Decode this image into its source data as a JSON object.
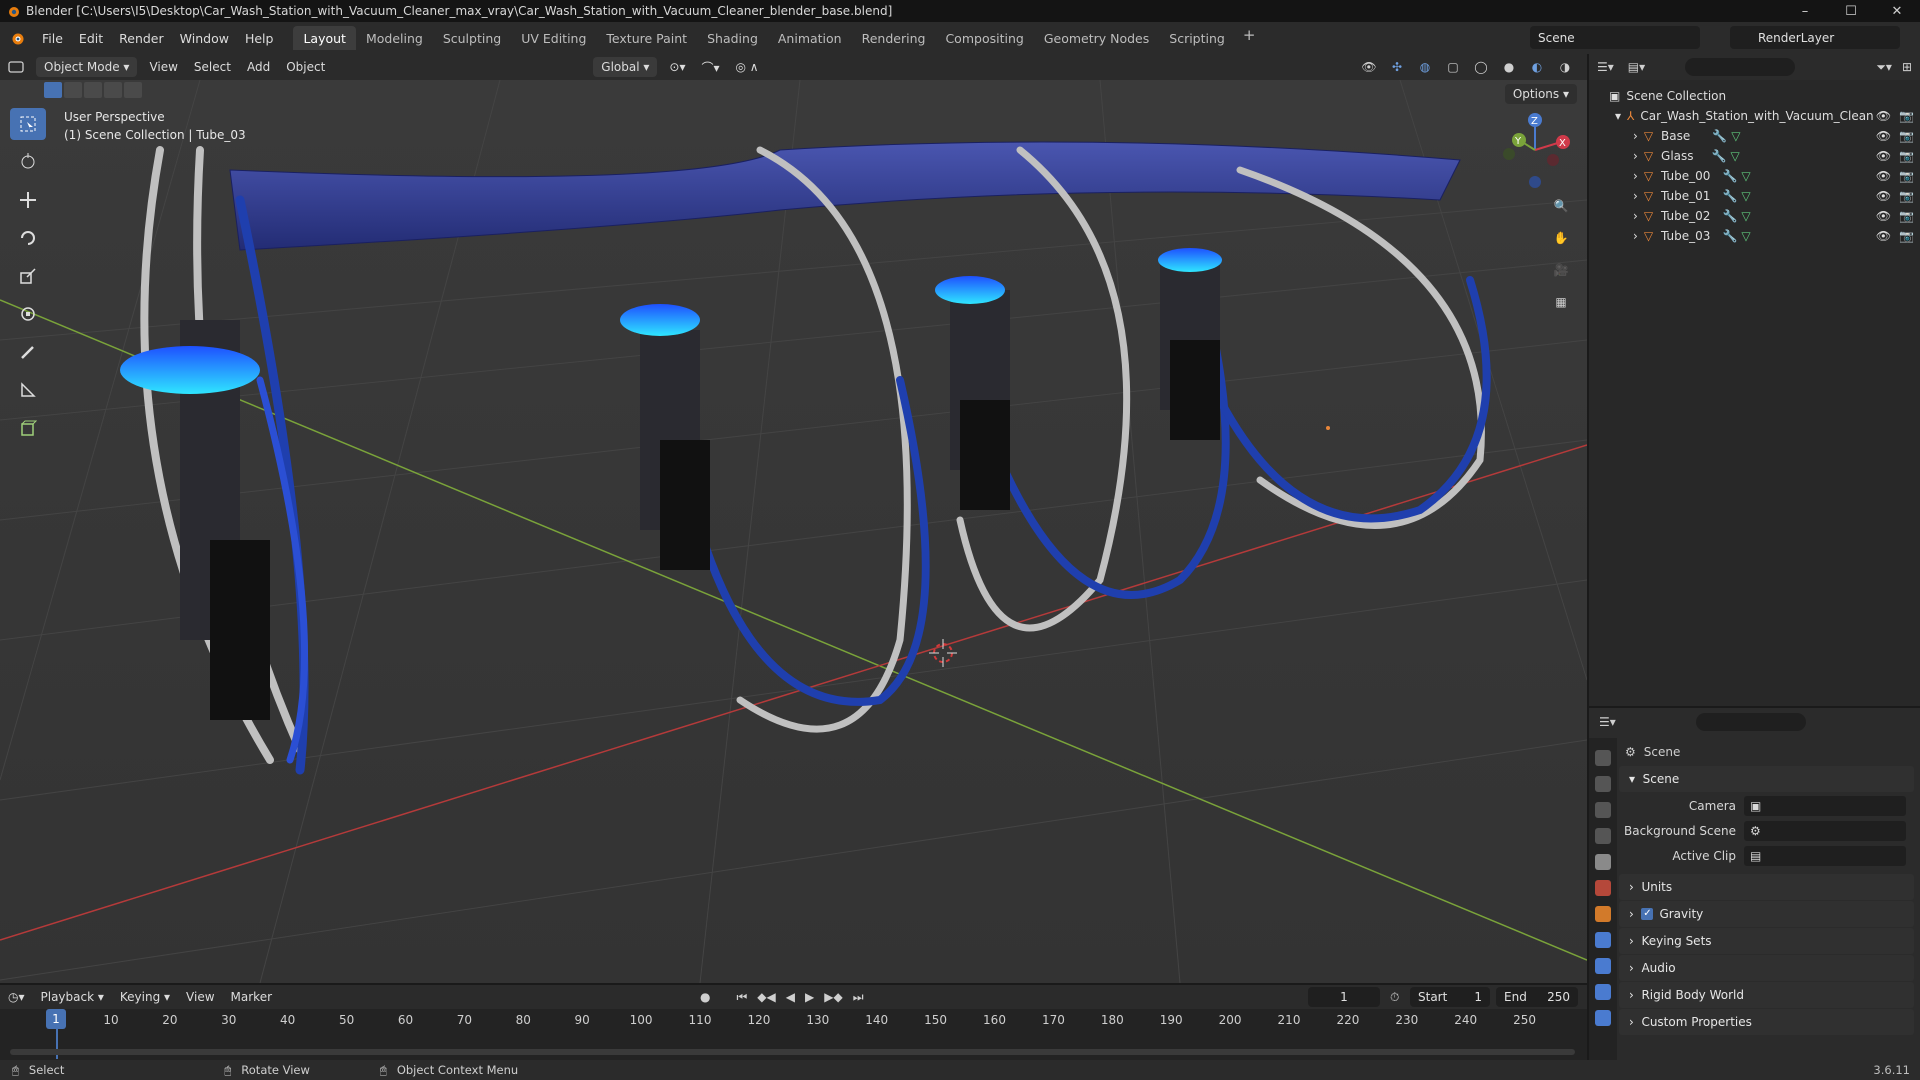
{
  "window": {
    "title": "Blender [C:\\Users\\I5\\Desktop\\Car_Wash_Station_with_Vacuum_Cleaner_max_vray\\Car_Wash_Station_with_Vacuum_Cleaner_blender_base.blend]",
    "controls": [
      "–",
      "☐",
      "✕"
    ]
  },
  "menu": [
    "File",
    "Edit",
    "Render",
    "Window",
    "Help"
  ],
  "workspaces": [
    "Layout",
    "Modeling",
    "Sculpting",
    "UV Editing",
    "Texture Paint",
    "Shading",
    "Animation",
    "Rendering",
    "Compositing",
    "Geometry Nodes",
    "Scripting"
  ],
  "active_workspace": "Layout",
  "scene_name": "Scene",
  "render_layer": "RenderLayer",
  "viewport": {
    "mode": "Object Mode",
    "menus": [
      "View",
      "Select",
      "Add",
      "Object"
    ],
    "orientation": "Global",
    "options_label": "Options",
    "perspective_label": "User Perspective",
    "context_label": "(1) Scene Collection | Tube_03",
    "axes": [
      "X",
      "Y",
      "Z"
    ]
  },
  "outliner": {
    "root": "Scene Collection",
    "collection": "Car_Wash_Station_with_Vacuum_Clean",
    "objects": [
      "Base",
      "Glass",
      "Tube_00",
      "Tube_01",
      "Tube_02",
      "Tube_03"
    ]
  },
  "properties": {
    "context": "Scene",
    "panel_scene": "Scene",
    "labels": {
      "camera": "Camera",
      "background": "Background Scene",
      "clip": "Active Clip"
    },
    "subpanels": [
      "Units",
      "Gravity",
      "Keying Sets",
      "Audio",
      "Rigid Body World",
      "Custom Properties"
    ],
    "gravity_checked": true
  },
  "timeline": {
    "menus": [
      "Playback",
      "Keying",
      "View",
      "Marker"
    ],
    "current_frame": "1",
    "start_label": "Start",
    "start": "1",
    "end_label": "End",
    "end": "250",
    "ruler": [
      "1",
      "10",
      "20",
      "30",
      "40",
      "50",
      "60",
      "70",
      "80",
      "90",
      "100",
      "110",
      "120",
      "130",
      "140",
      "150",
      "160",
      "170",
      "180",
      "190",
      "200",
      "210",
      "220",
      "230",
      "240",
      "250"
    ]
  },
  "status": {
    "select": "Select",
    "rotate": "Rotate View",
    "context": "Object Context Menu",
    "version": "3.6.11"
  },
  "colors": {
    "accent": "#4772b3",
    "mesh_orange": "#e8863a",
    "hose_blue": "#1f3fae",
    "canopy_blue": "#2e3a8c",
    "glow_cyan": "#2fe6ff"
  }
}
